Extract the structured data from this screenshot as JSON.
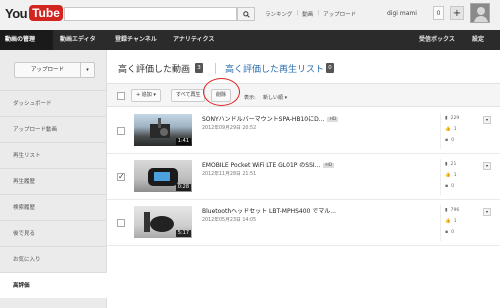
{
  "logo": {
    "you": "You",
    "tube": "Tube"
  },
  "header": {
    "search_placeholder": "",
    "links": [
      "ランキング",
      "|",
      "動画",
      "|",
      "アップロード"
    ],
    "username": "digi mami",
    "notification_count": "0",
    "plus": "+"
  },
  "nav": {
    "items": [
      "動画の管理",
      "動画エディタ",
      "登録チャンネル",
      "アナリティクス"
    ],
    "right": [
      "受信ボックス",
      "設定"
    ]
  },
  "sidebar": {
    "upload": "アップロード",
    "items": [
      "ダッシュボード",
      "アップロード動画",
      "再生リスト",
      "再生履歴",
      "検索履歴",
      "後で見る",
      "お気に入り",
      "高評価"
    ]
  },
  "main": {
    "title": "高く評価した動画",
    "title_count": "3",
    "playlist_title": "高く評価した再生リスト",
    "playlist_count": "0",
    "toolbar": {
      "add": "+ 追加 ▾",
      "play_all": "すべて再生",
      "delete": "削除",
      "sort_label": "表示:",
      "sort_value": "新しい順 ▾"
    },
    "videos": [
      {
        "title": "SONYハンドルバーマウントSPA-HB10にD...",
        "hd": "HD",
        "date": "2012年09月29日 20:52",
        "duration": "1:41",
        "views": "229",
        "likes": "1",
        "comments": "0",
        "checked": false
      },
      {
        "title": "EMOBILE Pocket WiFi LTE GL01P のSSI...",
        "hd": "HD",
        "date": "2012年11月28日 21:51",
        "duration": "0:28",
        "views": "21",
        "likes": "1",
        "comments": "0",
        "checked": true
      },
      {
        "title": "Bluetoothヘッドセット LBT-MPHS400 でマル...",
        "hd": "",
        "date": "2012年05月23日 14:05",
        "duration": "5:17",
        "views": "796",
        "likes": "1",
        "comments": "0",
        "checked": false
      }
    ]
  },
  "colors": {
    "youtube_red": "#d3251f",
    "nav_bg": "#2b2b2b",
    "link_blue": "#2a6db0",
    "annotation_red": "#dd2222"
  }
}
